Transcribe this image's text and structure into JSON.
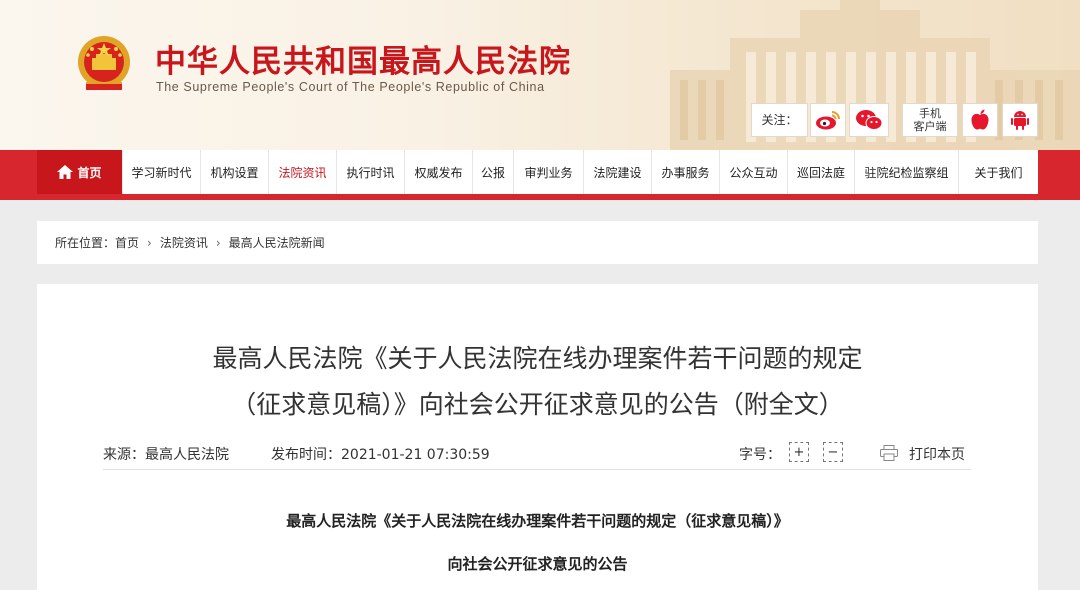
{
  "site": {
    "title": "中华人民共和国最高人民法院",
    "subtitle": "The Supreme People's Court of The People's Republic of China",
    "follow_label": "关注：",
    "mobile_client_label_line1": "手机",
    "mobile_client_label_line2": "客户端"
  },
  "nav": {
    "items": [
      {
        "label": "首页",
        "state": "home"
      },
      {
        "label": "学习新时代",
        "state": ""
      },
      {
        "label": "机构设置",
        "state": ""
      },
      {
        "label": "法院资讯",
        "state": "active"
      },
      {
        "label": "执行时讯",
        "state": ""
      },
      {
        "label": "权威发布",
        "state": ""
      },
      {
        "label": "公报",
        "state": ""
      },
      {
        "label": "审判业务",
        "state": ""
      },
      {
        "label": "法院建设",
        "state": ""
      },
      {
        "label": "办事服务",
        "state": ""
      },
      {
        "label": "公众互动",
        "state": ""
      },
      {
        "label": "巡回法庭",
        "state": ""
      },
      {
        "label": "驻院纪检监察组",
        "state": ""
      },
      {
        "label": "关于我们",
        "state": ""
      }
    ]
  },
  "breadcrumb": {
    "prefix": "所在位置：",
    "items": [
      "首页",
      "法院资讯",
      "最高人民法院新闻"
    ]
  },
  "article": {
    "title_line1": "最高人民法院《关于人民法院在线办理案件若干问题的规定",
    "title_line2": "（征求意见稿）》向社会公开征求意见的公告（附全文）",
    "source": "来源：最高人民法院",
    "publish_time": "发布时间：2021-01-21 07:30:59",
    "font_size_label": "字号：",
    "font_increase": "+",
    "font_decrease": "−",
    "print_label": "打印本页",
    "body_heading_1": "最高人民法院《关于人民法院在线办理案件若干问题的规定（征求意见稿）》",
    "body_heading_2": "向社会公开征求意见的公告"
  },
  "colors": {
    "brand_red": "#c8161d",
    "nav_band": "#d8262e",
    "page_bg": "#ececec"
  },
  "icons": [
    "national-emblem-icon",
    "weibo-icon",
    "wechat-icon",
    "apple-icon",
    "android-icon",
    "home-icon",
    "print-icon"
  ]
}
